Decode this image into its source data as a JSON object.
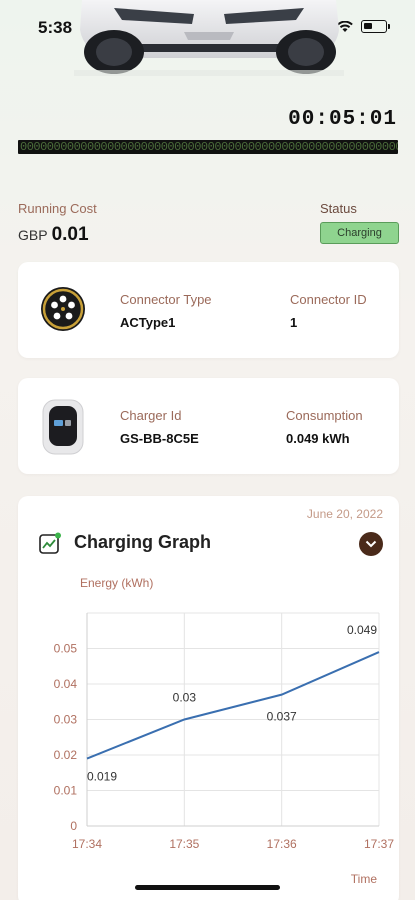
{
  "status_bar": {
    "time": "5:38"
  },
  "session": {
    "timer": "00:05:01",
    "progress_text": "0000000000000000000000000000000000000000000000000000000000000000000000"
  },
  "running_cost": {
    "label": "Running Cost",
    "currency": "GBP",
    "value": "0.01"
  },
  "status": {
    "label": "Status",
    "value": "Charging",
    "color": "#8fd48f"
  },
  "connector_card": {
    "icon": "connector-plug-icon",
    "type_label": "Connector Type",
    "type_value": "ACType1",
    "id_label": "Connector ID",
    "id_value": "1"
  },
  "charger_card": {
    "icon": "charger-device-icon",
    "id_label": "Charger Id",
    "id_value": "GS-BB-8C5E",
    "consumption_label": "Consumption",
    "consumption_value": "0.049 kWh"
  },
  "graph_card": {
    "date": "June 20, 2022",
    "title": "Charging Graph",
    "icon": "chart-trend-icon",
    "toggle_icon": "chevron-down-icon"
  },
  "chart_data": {
    "type": "line",
    "title": "Charging Graph",
    "ylabel": "Energy (kWh)",
    "xlabel": "Time",
    "x": [
      "17:34",
      "17:35",
      "17:36",
      "17:37"
    ],
    "values": [
      0.019,
      0.03,
      0.037,
      0.049
    ],
    "data_labels": [
      "0.019",
      "0.03",
      "0.037",
      "0.049"
    ],
    "yticks": [
      "0",
      "0.01",
      "0.02",
      "0.03",
      "0.04",
      "0.05"
    ],
    "ylim": [
      0,
      0.06
    ],
    "grid": true,
    "line_color": "#3a6fb0"
  }
}
